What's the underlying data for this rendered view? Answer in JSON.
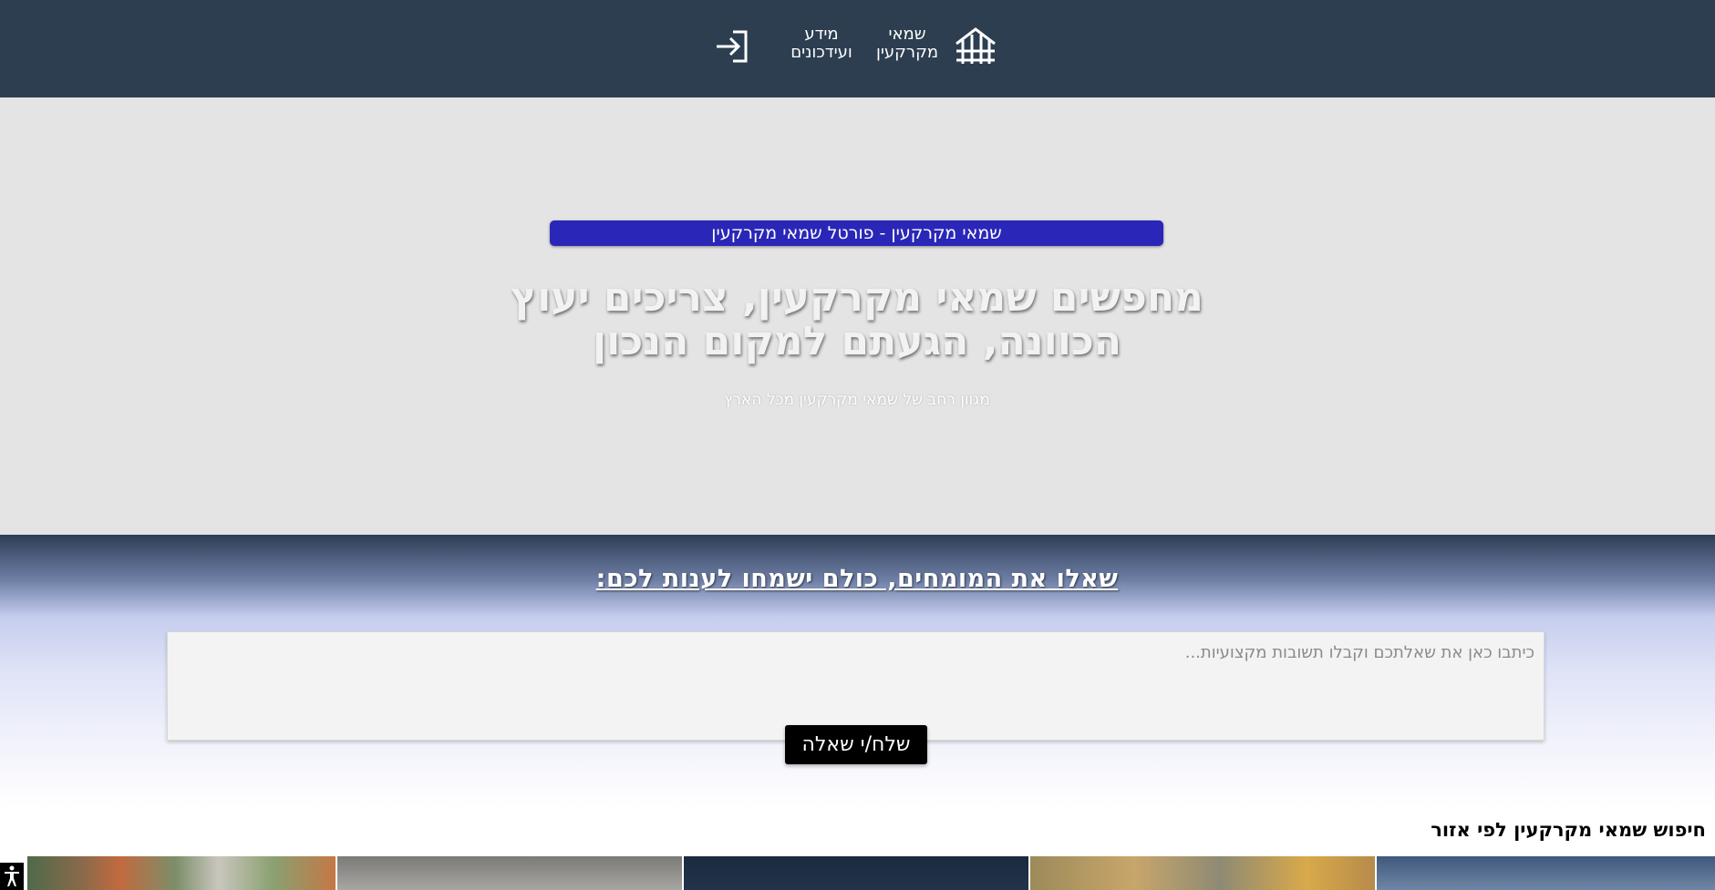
{
  "nav": {
    "logo_icon": "house-roof-icon",
    "real_estate_line1": "שמאי",
    "real_estate_line2": "מקרקעין",
    "info_line1": "מידע",
    "info_line2": "ועידכונים",
    "login_icon": "sign-in-icon"
  },
  "hero": {
    "badge": "שמאי מקרקעין - פורטל שמאי מקרקעין",
    "title": "מחפשים שמאי מקרקעין, צריכים יעוץ הכוונה, הגעתם למקום הנכון",
    "subtitle": "מגוון רחב של שמאי מקרקעין מכל הארץ"
  },
  "ask": {
    "heading": "שאלו את המומחים, כולם ישמחו לענות לכם:",
    "placeholder": "כיתבו כאן את שאלתכם וקבלו תשובות מקצועיות...",
    "submit_label": "שלח/י שאלה"
  },
  "regions": {
    "title": "חיפוש שמאי מקרקעין לפי אזור"
  },
  "accessibility": {
    "icon": "accessibility-icon"
  },
  "colors": {
    "header_bg": "#2c3e50",
    "hero_bg": "#e4e4e4",
    "badge_bg": "#2a27b8",
    "button_bg": "#000000"
  }
}
